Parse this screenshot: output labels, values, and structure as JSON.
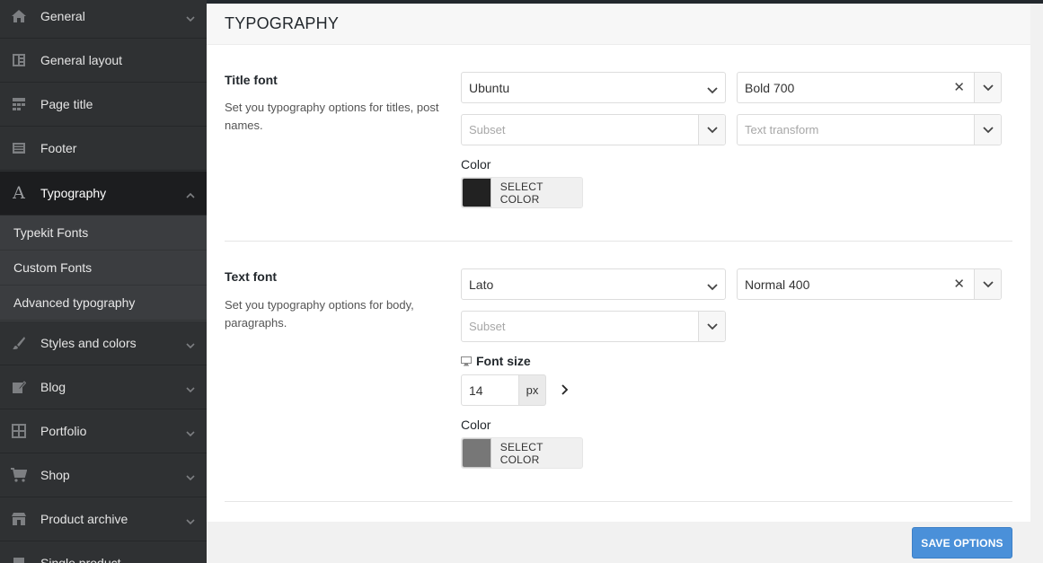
{
  "sidebar": {
    "items": [
      {
        "label": "General",
        "icon": "home-icon"
      },
      {
        "label": "General layout",
        "icon": "layout-icon"
      },
      {
        "label": "Page title",
        "icon": "page-title-icon"
      },
      {
        "label": "Footer",
        "icon": "footer-icon"
      },
      {
        "label": "Typography",
        "icon": "typography-icon"
      },
      {
        "label": "Styles and colors",
        "icon": "brush-icon"
      },
      {
        "label": "Blog",
        "icon": "edit-icon"
      },
      {
        "label": "Portfolio",
        "icon": "grid-icon"
      },
      {
        "label": "Shop",
        "icon": "cart-icon"
      },
      {
        "label": "Product archive",
        "icon": "store-icon"
      },
      {
        "label": "Single product",
        "icon": "product-icon"
      }
    ],
    "typography_sub": [
      {
        "label": "Typekit Fonts"
      },
      {
        "label": "Custom Fonts"
      },
      {
        "label": "Advanced typography"
      }
    ],
    "active_item": "Typography"
  },
  "panel": {
    "title": "TYPOGRAPHY",
    "title_font": {
      "heading": "Title font",
      "description": "Set you typography options for titles, post names.",
      "family": "Ubuntu",
      "weight": "Bold 700",
      "subset_placeholder": "Subset",
      "transform_placeholder": "Text transform",
      "color_label": "Color",
      "color_button": "SELECT COLOR",
      "color_value": "#222222"
    },
    "text_font": {
      "heading": "Text font",
      "description": "Set you typography options for body, paragraphs.",
      "family": "Lato",
      "weight": "Normal 400",
      "subset_placeholder": "Subset",
      "font_size_label": "Font size",
      "font_size_value": "14",
      "font_size_unit": "px",
      "color_label": "Color",
      "color_button": "SELECT COLOR",
      "color_value": "#777777"
    }
  },
  "footer": {
    "save_label": "SAVE OPTIONS"
  }
}
